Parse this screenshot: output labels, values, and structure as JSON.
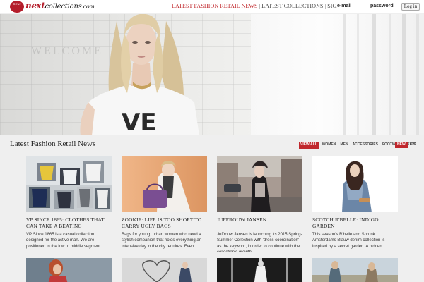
{
  "header": {
    "logo_badge": "next",
    "logo_brand": "next",
    "logo_rest": "collections",
    "logo_domain": ".com",
    "nav": [
      {
        "label": "LATEST FASHION RETAIL NEWS",
        "accent": true
      },
      {
        "label": "LATEST COLLECTIONS",
        "accent": false
      },
      {
        "label": "SIGN UP",
        "accent": false
      }
    ],
    "email_placeholder": "e-mail",
    "password_placeholder": "password",
    "login_label": "Log in"
  },
  "hero": {
    "wall_text": "WELCOME",
    "shirt_letters": "VE"
  },
  "section": {
    "title": "Latest Fashion Retail News",
    "filters": [
      "VIEW ALL",
      "WOMEN",
      "MEN",
      "ACCESSORIES",
      "FOOTWEAR",
      "KIDS"
    ],
    "sort": [
      "NEW",
      "A-Z"
    ]
  },
  "articles": [
    {
      "title": "VP SINCE 1865: CLOTHES THAT CAN TAKE A BEATING",
      "text": "VP Since 1865 is a casual collection designed for the active man. We are positioned in the low to middle segment.",
      "thumb_icon": "tshirts-image"
    },
    {
      "title": "ZOOKIE: LIFE IS TOO SHORT TO CARRY UGLY BAGS",
      "text": "Bags for young, urban women who need a stylish companion that holds everything an intensive day in the city requires. Even",
      "thumb_icon": "handbag-model-image"
    },
    {
      "title": "JUFFROUW JANSEN",
      "text": "Juffrouw Jansen is launching its 2015 Spring-Summer Collection with 'dress coordination' as the keyword, in order to continue with the collection's growth.",
      "thumb_icon": "street-model-image"
    },
    {
      "title": "SCOTCH R'BELLE: INDIGO GARDEN",
      "text": "This season's R'belle and Shrunk Amsterdams Blauw denim collection is inspired by a secret garden. A hidden",
      "thumb_icon": "denim-model-image"
    }
  ],
  "colors": {
    "brand_red": "#c0282d",
    "page_bg": "#efefef"
  }
}
